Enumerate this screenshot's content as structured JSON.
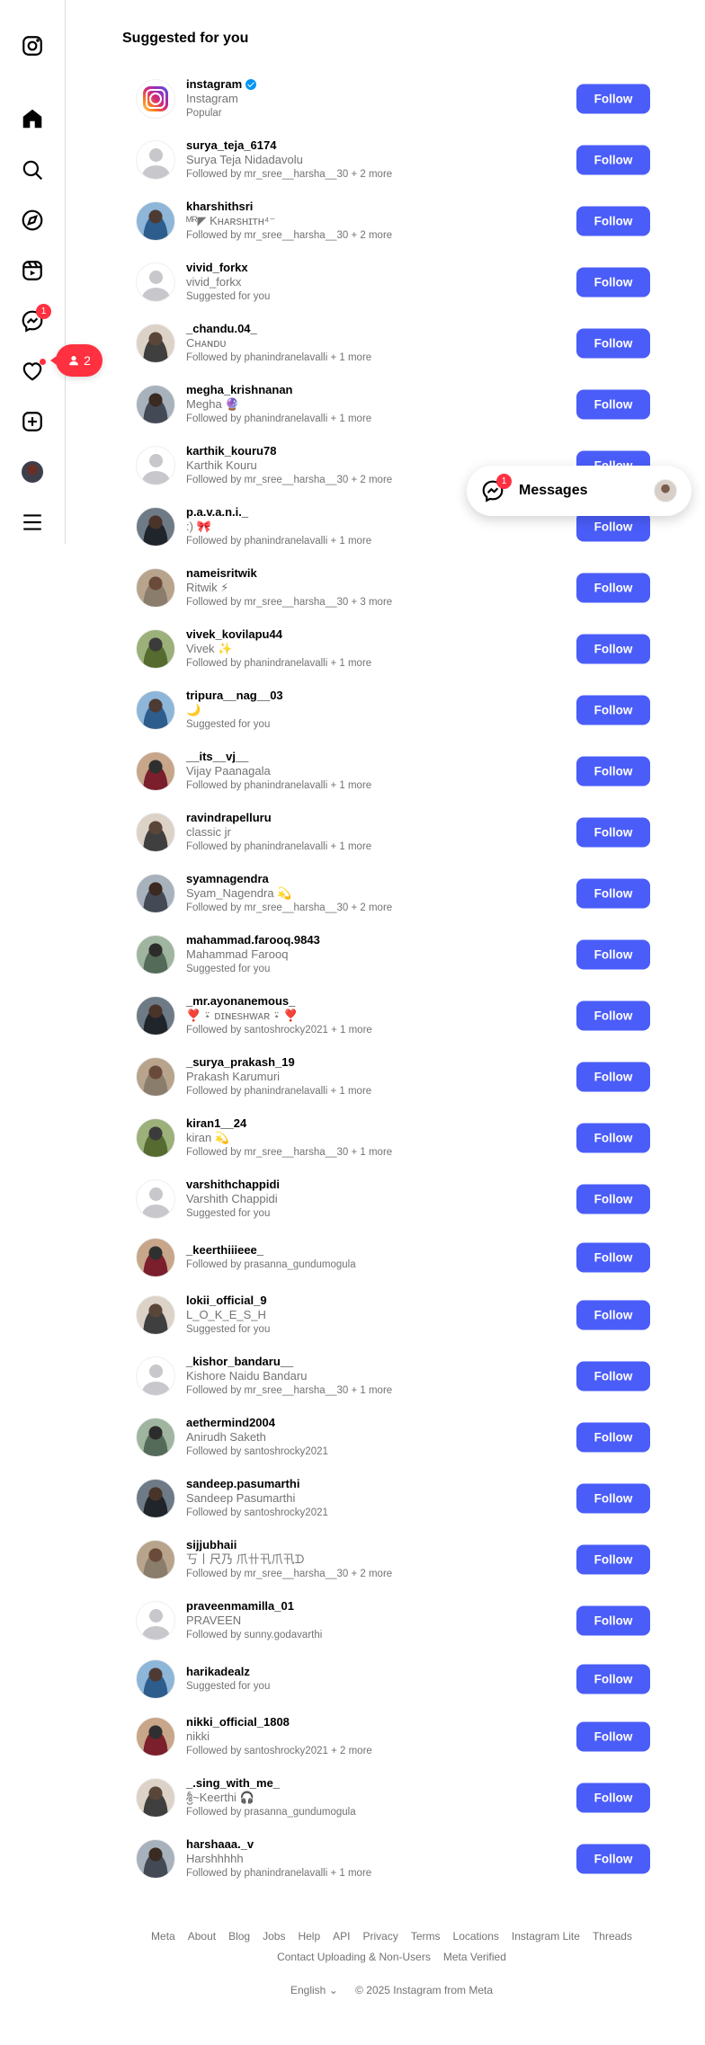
{
  "heading": "Suggested for you",
  "notification_pill": {
    "count": "2"
  },
  "nav": {
    "messenger_badge": "1"
  },
  "messages_float": {
    "label": "Messages",
    "badge": "1"
  },
  "follow_label": "Follow",
  "suggestions": [
    {
      "username": "instagram",
      "verified": true,
      "fullname": "Instagram",
      "subtitle": "Popular",
      "avatar": "instagram-logo"
    },
    {
      "username": "surya_teja_6174",
      "fullname": "Surya Teja Nidadavolu",
      "subtitle": "Followed by mr_sree__harsha__30 + 2 more",
      "avatar": "default"
    },
    {
      "username": "kharshithsri",
      "fullname": "ᴹᴿ◤ Kʜᴀʀsʜɪᴛʜ⁴⁻",
      "subtitle": "Followed by mr_sree__harsha__30 + 2 more",
      "avatar": "photo"
    },
    {
      "username": "vivid_forkx",
      "fullname": "vivid_forkx",
      "subtitle": "Suggested for you",
      "avatar": "default"
    },
    {
      "username": "_chandu.04_",
      "fullname": "Cʜᴀɴᴅᴜ",
      "subtitle": "Followed by phanindranelavalli + 1 more",
      "avatar": "photo"
    },
    {
      "username": "megha_krishnanan",
      "fullname": "Megha 🔮",
      "subtitle": "Followed by phanindranelavalli + 1 more",
      "avatar": "photo"
    },
    {
      "username": "karthik_kouru78",
      "fullname": "Karthik Kouru",
      "subtitle": "Followed by mr_sree__harsha__30 + 2 more",
      "avatar": "default"
    },
    {
      "username": "p.a.v.a.n.i._",
      "fullname": ":) 🎀",
      "subtitle": "Followed by phanindranelavalli + 1 more",
      "avatar": "photo"
    },
    {
      "username": "nameisritwik",
      "fullname": "Ritwik ⚡",
      "subtitle": "Followed by mr_sree__harsha__30 + 3 more",
      "avatar": "photo"
    },
    {
      "username": "vivek_kovilapu44",
      "fullname": "Vivek ✨",
      "subtitle": "Followed by phanindranelavalli + 1 more",
      "avatar": "photo"
    },
    {
      "username": "tripura__nag__03",
      "fullname": "🌙",
      "subtitle": "Suggested for you",
      "avatar": "photo"
    },
    {
      "username": "__its__vj__",
      "fullname": "Vijay Paanagala",
      "subtitle": "Followed by phanindranelavalli + 1 more",
      "avatar": "photo"
    },
    {
      "username": "ravindrapelluru",
      "fullname": "classic jr",
      "subtitle": "Followed by phanindranelavalli + 1 more",
      "avatar": "photo"
    },
    {
      "username": "syamnagendra",
      "fullname": "Syam_Nagendra 💫",
      "subtitle": "Followed by mr_sree__harsha__30 + 2 more",
      "avatar": "photo"
    },
    {
      "username": "mahammad.farooq.9843",
      "fullname": "Mahammad Farooq",
      "subtitle": "Suggested for you",
      "avatar": "photo"
    },
    {
      "username": "_mr.ayonanemous_",
      "fullname": "❣️ ⍣ ᴅɪɴᴇsʜᴡᴀʀ ⍣ ❣️",
      "subtitle": "Followed by santoshrocky2021 + 1 more",
      "avatar": "photo"
    },
    {
      "username": "_surya_prakash_19",
      "fullname": "Prakash Karumuri",
      "subtitle": "Followed by phanindranelavalli + 1 more",
      "avatar": "photo"
    },
    {
      "username": "kiran1__24",
      "fullname": "kiran 💫",
      "subtitle": "Followed by mr_sree__harsha__30 + 1 more",
      "avatar": "photo"
    },
    {
      "username": "varshithchappidi",
      "fullname": "Varshith Chappidi",
      "subtitle": "Suggested for you",
      "avatar": "default"
    },
    {
      "username": "_keerthiiieee_",
      "fullname": "",
      "subtitle": "Followed by prasanna_gundumogula",
      "avatar": "photo",
      "short": true
    },
    {
      "username": "lokii_official_9",
      "fullname": "L_O_K_E_S_H",
      "subtitle": "Suggested for you",
      "avatar": "photo"
    },
    {
      "username": "_kishor_bandaru__",
      "fullname": "Kishore Naidu Bandaru",
      "subtitle": "Followed by mr_sree__harsha__30 + 1 more",
      "avatar": "default"
    },
    {
      "username": "aethermind2004",
      "fullname": "Anirudh Saketh",
      "subtitle": "Followed by santoshrocky2021",
      "avatar": "photo"
    },
    {
      "username": "sandeep.pasumarthi",
      "fullname": "Sandeep Pasumarthi",
      "subtitle": "Followed by santoshrocky2021",
      "avatar": "photo"
    },
    {
      "username": "sijjubhaii",
      "fullname": "丂丨尺乃 爪卄卂爪卂ᗪ",
      "subtitle": "Followed by mr_sree__harsha__30 + 2 more",
      "avatar": "photo"
    },
    {
      "username": "praveenmamilla_01",
      "fullname": "PRAVEEN",
      "subtitle": "Followed by sunny.godavarthi",
      "avatar": "default"
    },
    {
      "username": "harikadealz",
      "fullname": "",
      "subtitle": "Suggested for you",
      "avatar": "photo",
      "short": true
    },
    {
      "username": "nikki_official_1808",
      "fullname": "nikki",
      "subtitle": "Followed by santoshrocky2021 + 2 more",
      "avatar": "photo"
    },
    {
      "username": "_.sing_with_me_",
      "fullname": "శ్రీ~Keerthi 🎧",
      "subtitle": "Followed by prasanna_gundumogula",
      "avatar": "photo"
    },
    {
      "username": "harshaaa._v",
      "fullname": "Harshhhhh",
      "subtitle": "Followed by phanindranelavalli + 1 more",
      "avatar": "photo"
    }
  ],
  "footer": {
    "links": [
      "Meta",
      "About",
      "Blog",
      "Jobs",
      "Help",
      "API",
      "Privacy",
      "Terms",
      "Locations",
      "Instagram Lite",
      "Threads"
    ],
    "links2": [
      "Contact Uploading & Non-Users",
      "Meta Verified"
    ],
    "language": "English",
    "copyright": "© 2025 Instagram from Meta"
  }
}
